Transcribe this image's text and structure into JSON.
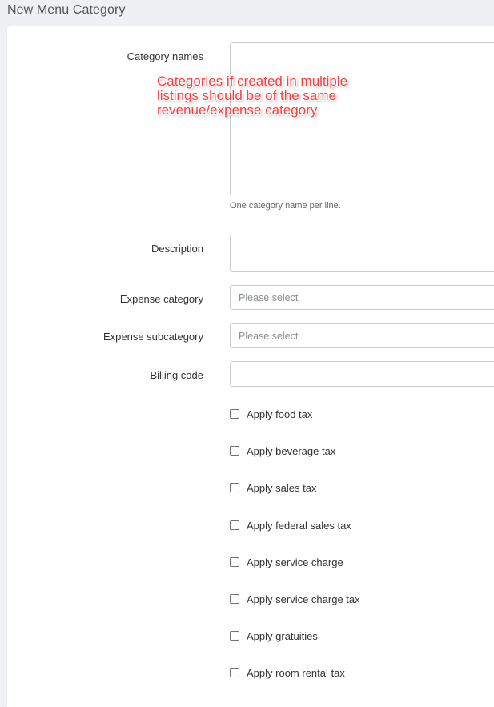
{
  "page": {
    "title": "New Menu Category"
  },
  "form": {
    "category_names_label": "Category names",
    "category_names_value": "",
    "category_names_help": "One category name per line.",
    "annotation_lines": [
      "Categories if created in multiple",
      "listings should be of the same",
      "revenue/expense category"
    ],
    "description_label": "Description",
    "description_value": "",
    "expense_category_label": "Expense category",
    "expense_category_placeholder": "Please select",
    "expense_subcategory_label": "Expense subcategory",
    "expense_subcategory_placeholder": "Please select",
    "billing_code_label": "Billing code",
    "billing_code_value": ""
  },
  "checkboxes": [
    {
      "label": "Apply food tax",
      "checked": false
    },
    {
      "label": "Apply beverage tax",
      "checked": false
    },
    {
      "label": "Apply sales tax",
      "checked": false
    },
    {
      "label": "Apply federal sales tax",
      "checked": false
    },
    {
      "label": "Apply service charge",
      "checked": false
    },
    {
      "label": "Apply service charge tax",
      "checked": false
    },
    {
      "label": "Apply gratuities",
      "checked": false
    },
    {
      "label": "Apply room rental tax",
      "checked": false
    }
  ],
  "colors": {
    "annotation": "#ff3b3b",
    "background": "#eef0f3"
  }
}
